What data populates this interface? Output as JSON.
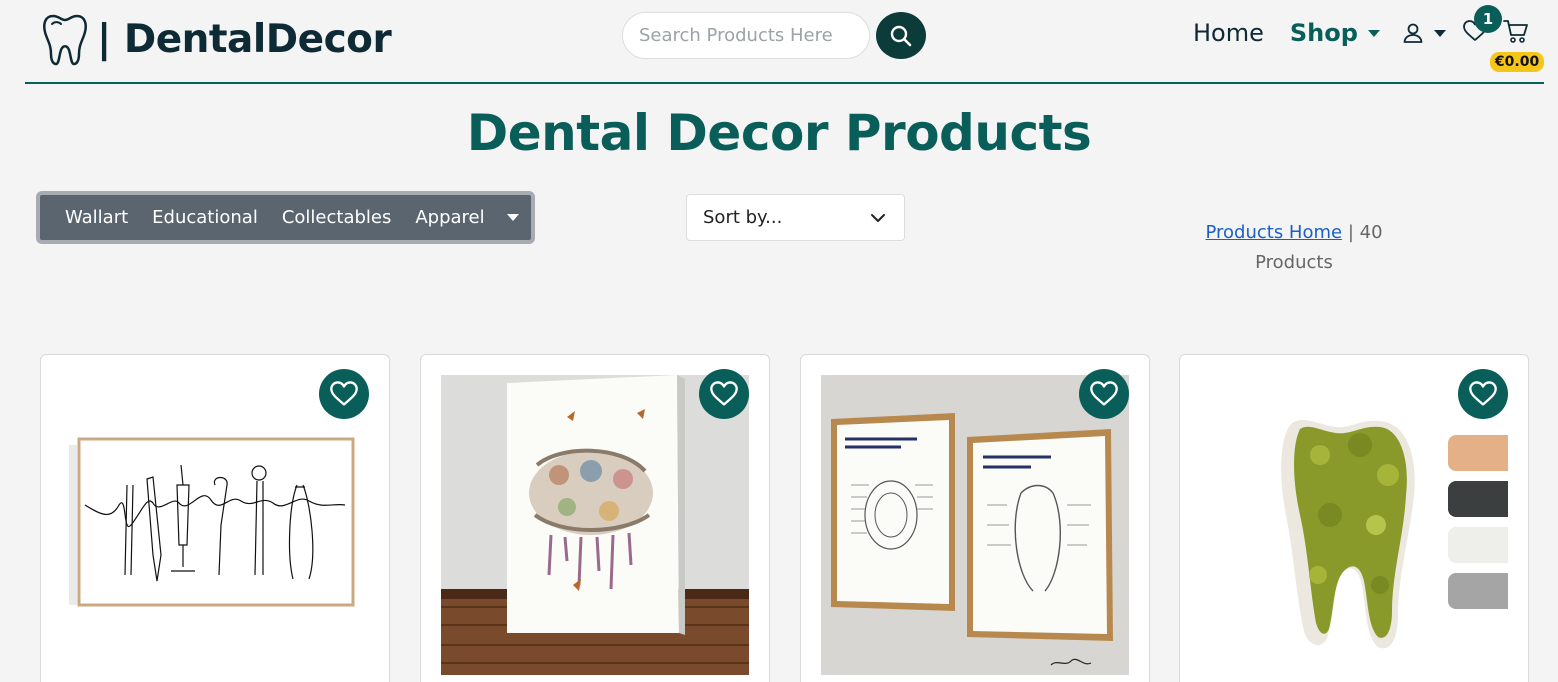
{
  "header": {
    "brand": "| DentalDecor",
    "search_placeholder": "Search Products Here",
    "nav": {
      "home": "Home",
      "shop": "Shop",
      "wishlist_count": "1",
      "cart_total": "€0.00"
    }
  },
  "page": {
    "title": "Dental Decor Products"
  },
  "categories": [
    "Wallart",
    "Educational",
    "Collectables",
    "Apparel"
  ],
  "sort": {
    "label": "Sort by..."
  },
  "breadcrumb": {
    "link": "Products Home",
    "separator": "|",
    "count_text": "40 Products"
  },
  "colors": {
    "brand": "#0a5e5a",
    "dark": "#0b3c3a",
    "badge": "#f5c518",
    "swatches": [
      "#e3b087",
      "#3b3f40",
      "#eeeeea",
      "#a5a5a5"
    ]
  },
  "products": [
    {
      "alt": "dental instruments line art print"
    },
    {
      "alt": "watercolour teeth canvas print"
    },
    {
      "alt": "dental anatomy framed posters"
    },
    {
      "alt": "moss tooth wall decoration"
    }
  ]
}
